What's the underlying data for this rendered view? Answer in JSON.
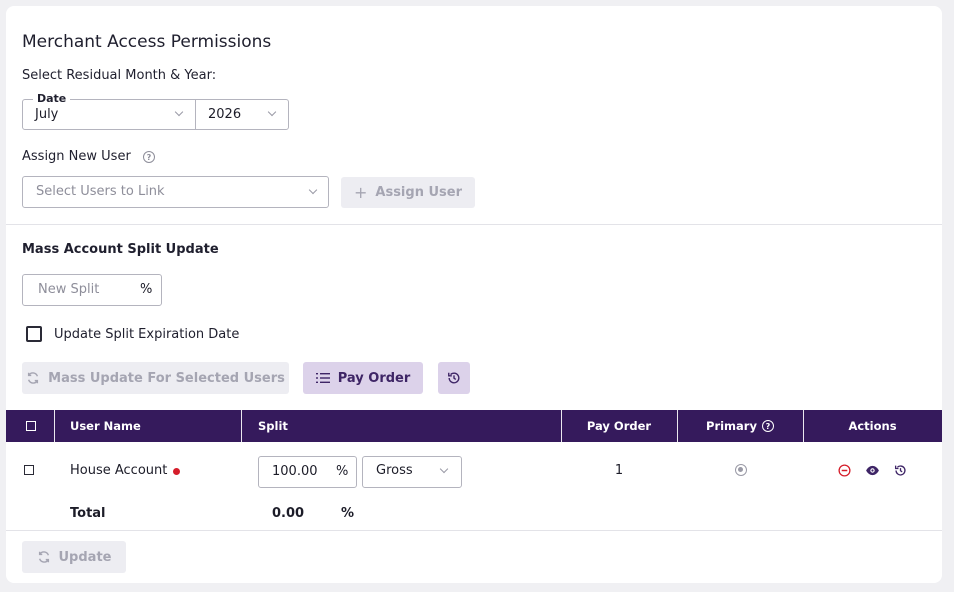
{
  "page": {
    "title": "Merchant Access Permissions",
    "residual_label": "Select Residual Month & Year:",
    "date_legend": "Date",
    "month_value": "July",
    "year_value": "2026",
    "assign_label": "Assign New User",
    "assign_help_icon": "question-circle-icon",
    "users_placeholder": "Select Users to Link",
    "assign_button": "Assign User",
    "mass_title": "Mass Account Split Update",
    "new_split_placeholder": "New Split",
    "percent": "%",
    "expiration_label": "Update Split Expiration Date",
    "mass_update_button": "Mass Update For Selected Users",
    "pay_order_button": "Pay Order",
    "update_button": "Update"
  },
  "table": {
    "headers": {
      "user_name": "User Name",
      "split": "Split",
      "pay_order": "Pay Order",
      "primary": "Primary",
      "actions": "Actions"
    },
    "rows": [
      {
        "user_name": "House Account",
        "split_value": "100.00",
        "split_unit": "%",
        "split_type": "Gross",
        "pay_order": "1",
        "primary": true
      }
    ],
    "total": {
      "label": "Total",
      "value": "0.00",
      "unit": "%"
    }
  },
  "colors": {
    "header_bg": "#351a5c",
    "accent": "#3e2566",
    "remove_icon": "#d51d2a"
  }
}
